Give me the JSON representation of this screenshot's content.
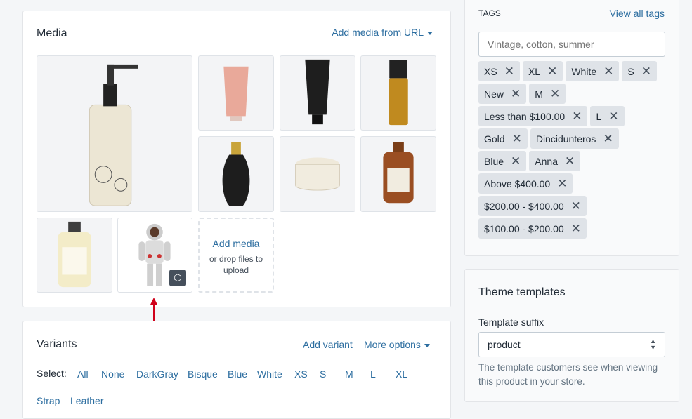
{
  "media": {
    "title": "Media",
    "add_from_url": "Add media from URL",
    "add_media": "Add media",
    "drop_hint": "or drop files to upload",
    "items": [
      "soap-dispenser",
      "pink-tube",
      "black-tube",
      "gold-spray",
      "perfume-bottle",
      "cream-jar",
      "amber-bottle",
      "cream-bottle",
      "astronaut-3d-model"
    ]
  },
  "variants": {
    "title": "Variants",
    "add_variant": "Add variant",
    "more_options": "More options",
    "select_label": "Select:",
    "options": [
      "All",
      "None",
      "DarkGray",
      "Bisque",
      "Blue",
      "White",
      "XS",
      "S",
      "M",
      "L",
      "XL",
      "Strap",
      "Leather"
    ]
  },
  "tags": {
    "title": "TAGS",
    "view_all": "View all tags",
    "placeholder": "Vintage, cotton, summer",
    "rows": [
      [
        "XS",
        "XL",
        "White",
        "S"
      ],
      [
        "New",
        "M"
      ],
      [
        "Less than $100.00",
        "L"
      ],
      [
        "Gold",
        "Dincidunteros"
      ],
      [
        "Blue",
        "Anna"
      ],
      [
        "Above $400.00"
      ],
      [
        "$200.00 - $400.00"
      ],
      [
        "$100.00 - $200.00"
      ]
    ]
  },
  "theme": {
    "title": "Theme templates",
    "suffix_label": "Template suffix",
    "suffix_value": "product",
    "help": "The template customers see when viewing this product in your store."
  },
  "colors": {
    "link": "#2d6ea0",
    "arrow": "#d0021b"
  }
}
